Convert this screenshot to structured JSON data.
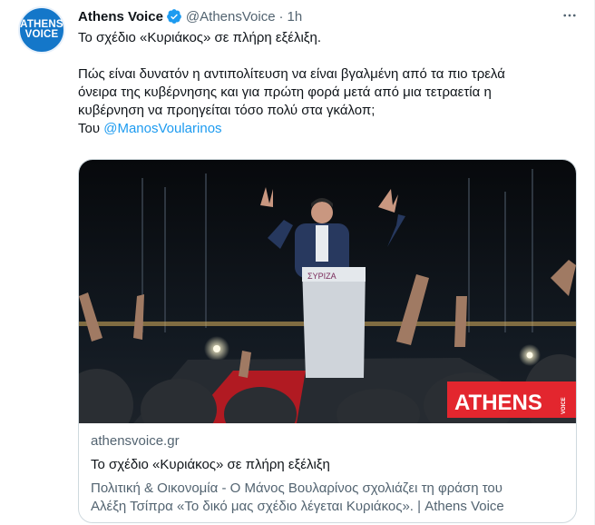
{
  "author": {
    "avatar_line1": "ATHENS",
    "avatar_line2": "VOICE",
    "name": "Athens Voice",
    "handle": "@AthensVoice",
    "separator": "·",
    "time": "1h"
  },
  "tweet": {
    "line1": "Το σχέδιο «Κυριάκος» σε πλήρη εξέλιξη.",
    "para_line1": "Πώς είναι δυνατόν η αντιπολίτευση να είναι βγαλμένη από τα πιο τρελά",
    "para_line2": "όνειρα της κυβέρνησης και για πρώτη φορά μετά από μια τετραετία η",
    "para_line3": "κυβέρνηση να προηγείται τόσο πολύ στα γκάλοπ;",
    "by_prefix": "Του",
    "mention": "@ManosVoularinos"
  },
  "card": {
    "podium_logo": "ΣΥΡΙΖΑ",
    "watermark": "ATHENS",
    "watermark_small": "VOICE",
    "domain": "athensvoice.gr",
    "title": "Το σχέδιο «Κυριάκος» σε πλήρη εξέλιξη",
    "desc_line1": "Πολιτική & Οικονομία - Ο Μάνος Βουλαρίνος σχολιάζει τη φράση του",
    "desc_line2": "Αλέξη Τσίπρα «Το δικό μας σχέδιο λέγεται Κυριάκος». | Athens Voice"
  },
  "colors": {
    "verified": "#1d9bf0",
    "link": "#1d9bf0",
    "avatar_bg": "#1477c9",
    "watermark_bg": "#e3262e"
  },
  "icons": [
    "verified-badge-icon",
    "more-icon"
  ]
}
